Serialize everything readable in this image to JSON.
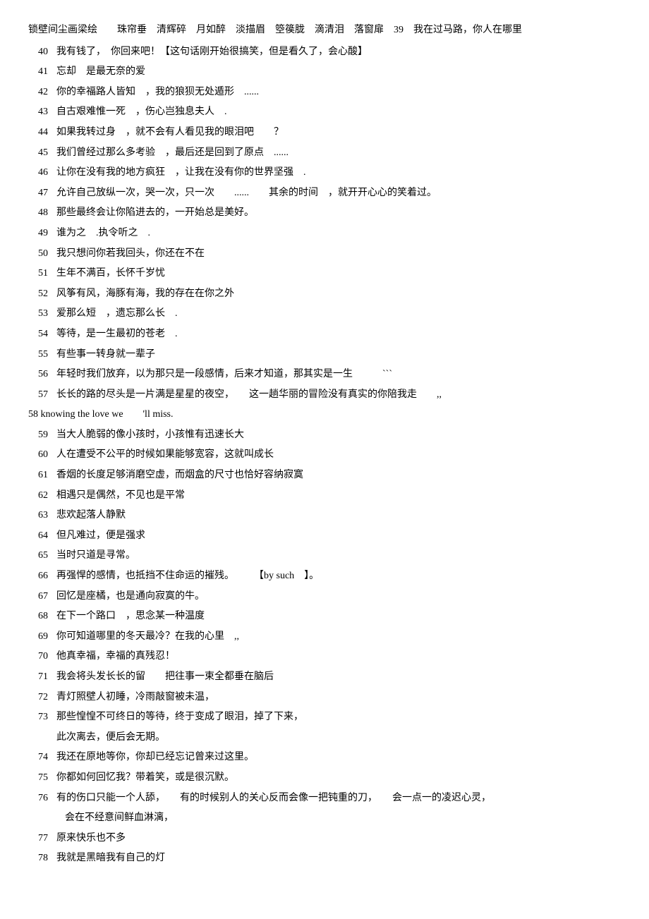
{
  "header": {
    "line1": "锁壁间尘画梁绘　　珠帘垂　清辉碎　月如醉　淡描眉　箜篌胧　滴清泪　落窗扉　39　我在过马路，你人在哪里"
  },
  "entries": [
    {
      "num": "40",
      "text": "我有钱了，　你回来吧！【这句话刚开始很搞笑，但是看久了，会心酸】"
    },
    {
      "num": "41",
      "text": "忘却　是最无奈的爱"
    },
    {
      "num": "42",
      "text": "你的幸福路人皆知　，我的狼狈无处遁形　......"
    },
    {
      "num": "43",
      "text": "自古艰难惟一死　，伤心岂独息夫人　."
    },
    {
      "num": "44",
      "text": "如果我转过身　，就不会有人看见我的眼泪吧　　？"
    },
    {
      "num": "45",
      "text": "我们曾经过那么多考验　，最后还是回到了原点　......"
    },
    {
      "num": "46",
      "text": "让你在没有我的地方疯狂　，让我在没有你的世界坚强　."
    },
    {
      "num": "47",
      "text": "允许自己放纵一次，哭一次，只一次　　......　　其余的时间　，就开开心心的笑着过。"
    },
    {
      "num": "48",
      "text": "那些最终会让你陷进去的，一开始总是美好。"
    },
    {
      "num": "49",
      "text": "谁为之　.执令听之　."
    },
    {
      "num": "50",
      "text": "我只想问你若我回头，你还在不在"
    },
    {
      "num": "51",
      "text": "生年不满百，长怀千岁忧"
    },
    {
      "num": "52",
      "text": "风筝有风，海豚有海，我的存在在你之外"
    },
    {
      "num": "53",
      "text": "爱那么短　，遗忘那么长　."
    },
    {
      "num": "54",
      "text": "等待，是一生最初的苍老　."
    },
    {
      "num": "55",
      "text": "有些事一转身就一辈子"
    },
    {
      "num": "56",
      "text": "年轻时我们放弃，以为那只是一段感情，后来才知道，那其实是一生　　　```"
    },
    {
      "num": "57",
      "text": "长长的路的尽头是一片满是星星的夜空，　　这一趟华丽的冒险没有真实的你陪我走　　,,"
    },
    {
      "num": "58",
      "text": "knowing the love we　　'll miss.",
      "special": true
    },
    {
      "num": "59",
      "text": "当大人脆弱的像小孩时，小孩惟有迅速长大"
    },
    {
      "num": "60",
      "text": "人在遭受不公平的时候如果能够宽容，这就叫成长"
    },
    {
      "num": "61",
      "text": "香烟的长度足够消磨空虚，而烟盒的尺寸也恰好容纳寂寞"
    },
    {
      "num": "62",
      "text": "相遇只是偶然，不见也是平常"
    },
    {
      "num": "63",
      "text": "悲欢起落人静默"
    },
    {
      "num": "64",
      "text": "但凡难过，便是强求"
    },
    {
      "num": "65",
      "text": "当时只道是寻常。"
    },
    {
      "num": "66",
      "text": "再强悍的感情，也抵挡不住命运的摧残。　　　【by such　】。"
    },
    {
      "num": "67",
      "text": "回忆是座橘，也是通向寂寞的牛。"
    },
    {
      "num": "68",
      "text": "在下一个路口　，思念某一种温度"
    },
    {
      "num": "69",
      "text": "你可知道哪里的冬天最冷？在我的心里　,,"
    },
    {
      "num": "70",
      "text": "他真幸福，幸福的真残忍！"
    },
    {
      "num": "71",
      "text": "我会将头发长长的留　　把往事一束全都垂在脑后"
    },
    {
      "num": "72",
      "text": "青灯照壁人初睡，冷雨敲窗被未温，"
    },
    {
      "num": "73a",
      "text": "那些惶惶不可终日的等待，终于变成了眼泪，掉了下来，"
    },
    {
      "num": "73b",
      "text": "此次离去，便后会无期。"
    },
    {
      "num": "74",
      "text": "我还在原地等你，你却已经忘记曾来过这里。"
    },
    {
      "num": "75",
      "text": "你都如何回忆我？带着笑，或是很沉默。"
    },
    {
      "num": "76",
      "text": "有的伤口只能一个人舔，　　有的时候别人的关心反而会像一把钝重的刀，　　会一点一的凌迟心灵，",
      "continuation": "会在不经意间鲜血淋漓，"
    },
    {
      "num": "77",
      "text": "原来快乐也不多"
    },
    {
      "num": "78",
      "text": "我就是黑暗我有自己的灯"
    }
  ]
}
